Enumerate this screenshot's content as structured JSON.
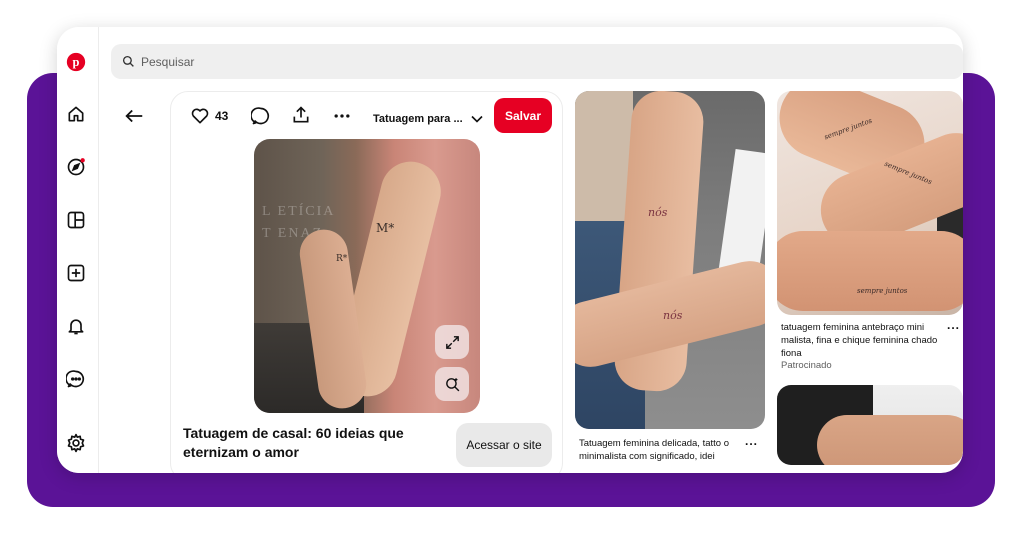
{
  "search": {
    "placeholder": "Pesquisar"
  },
  "sidebar": {
    "items": [
      {
        "icon": "pinterest-logo-icon"
      },
      {
        "icon": "home-icon"
      },
      {
        "icon": "explore-icon"
      },
      {
        "icon": "board-icon"
      },
      {
        "icon": "create-icon"
      },
      {
        "icon": "notifications-icon"
      },
      {
        "icon": "messages-icon"
      },
      {
        "icon": "settings-icon"
      }
    ]
  },
  "pin": {
    "like_count": "43",
    "board_select": "Tatuagem para ...",
    "save_label": "Salvar",
    "title": "Tatuagem de casal: 60 ideias que eternizam o amor",
    "visit_label": "Acessar o site",
    "image": {
      "watermark_line1": "L  ETÍCIA",
      "watermark_line2": "T  ENAZ",
      "tattoo_1": "M*",
      "tattoo_2": "R*"
    }
  },
  "feed": [
    {
      "caption": "Tatuagem feminina delicada, tatto o minimalista com significado, idei",
      "more": "...",
      "tattoo_1": "nós",
      "tattoo_2": "nós"
    },
    {
      "caption": "tatuagem feminina antebraço mini malista, fina e chique feminina chado fiona",
      "more": "...",
      "sponsored": "Patrocinado",
      "tattoo_1": "sempre juntos",
      "tattoo_2": "sempre juntos",
      "tattoo_3": "sempre juntos"
    }
  ],
  "colors": {
    "accent": "#e60023",
    "frame_purple": "#5b1397",
    "search_bg": "#efefef"
  }
}
